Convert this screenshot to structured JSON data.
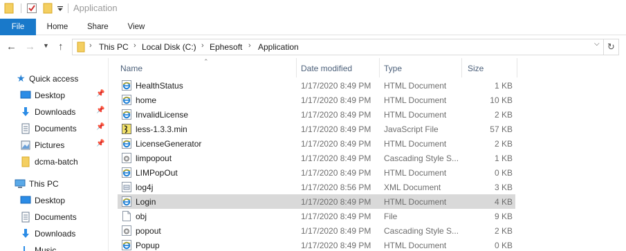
{
  "window": {
    "title": "Application"
  },
  "ribbon": {
    "tabs": [
      {
        "label": "File"
      },
      {
        "label": "Home"
      },
      {
        "label": "Share"
      },
      {
        "label": "View"
      }
    ]
  },
  "address": {
    "crumbs": [
      "This PC",
      "Local Disk (C:)",
      "Ephesoft",
      "Application"
    ]
  },
  "nav": {
    "quick_access": "Quick access",
    "quick_items": [
      {
        "label": "Desktop",
        "pinned": true,
        "icon": "desktop-icon"
      },
      {
        "label": "Downloads",
        "pinned": true,
        "icon": "downloads-icon"
      },
      {
        "label": "Documents",
        "pinned": true,
        "icon": "documents-icon"
      },
      {
        "label": "Pictures",
        "pinned": true,
        "icon": "pictures-icon"
      },
      {
        "label": "dcma-batch",
        "pinned": false,
        "icon": "folder-icon"
      }
    ],
    "this_pc": "This PC",
    "pc_items": [
      {
        "label": "Desktop",
        "icon": "desktop-icon"
      },
      {
        "label": "Documents",
        "icon": "documents-icon"
      },
      {
        "label": "Downloads",
        "icon": "downloads-icon"
      },
      {
        "label": "Music",
        "icon": "music-icon"
      }
    ]
  },
  "columns": {
    "name": "Name",
    "date": "Date modified",
    "type": "Type",
    "size": "Size"
  },
  "files": [
    {
      "name": "HealthStatus",
      "date": "1/17/2020 8:49 PM",
      "type": "HTML Document",
      "size": "1 KB",
      "icon": "html-icon"
    },
    {
      "name": "home",
      "date": "1/17/2020 8:49 PM",
      "type": "HTML Document",
      "size": "10 KB",
      "icon": "html-icon"
    },
    {
      "name": "InvalidLicense",
      "date": "1/17/2020 8:49 PM",
      "type": "HTML Document",
      "size": "2 KB",
      "icon": "html-icon"
    },
    {
      "name": "less-1.3.3.min",
      "date": "1/17/2020 8:49 PM",
      "type": "JavaScript File",
      "size": "57 KB",
      "icon": "js-icon"
    },
    {
      "name": "LicenseGenerator",
      "date": "1/17/2020 8:49 PM",
      "type": "HTML Document",
      "size": "2 KB",
      "icon": "html-icon"
    },
    {
      "name": "limpopout",
      "date": "1/17/2020 8:49 PM",
      "type": "Cascading Style S...",
      "size": "1 KB",
      "icon": "css-icon"
    },
    {
      "name": "LIMPopOut",
      "date": "1/17/2020 8:49 PM",
      "type": "HTML Document",
      "size": "0 KB",
      "icon": "html-icon"
    },
    {
      "name": "log4j",
      "date": "1/17/2020 8:56 PM",
      "type": "XML Document",
      "size": "3 KB",
      "icon": "xml-icon"
    },
    {
      "name": "Login",
      "date": "1/17/2020 8:49 PM",
      "type": "HTML Document",
      "size": "4 KB",
      "icon": "html-icon",
      "selected": true
    },
    {
      "name": "obj",
      "date": "1/17/2020 8:49 PM",
      "type": "File",
      "size": "9 KB",
      "icon": "file-icon"
    },
    {
      "name": "popout",
      "date": "1/17/2020 8:49 PM",
      "type": "Cascading Style S...",
      "size": "2 KB",
      "icon": "css-icon"
    },
    {
      "name": "Popup",
      "date": "1/17/2020 8:49 PM",
      "type": "HTML Document",
      "size": "0 KB",
      "icon": "html-icon"
    }
  ]
}
